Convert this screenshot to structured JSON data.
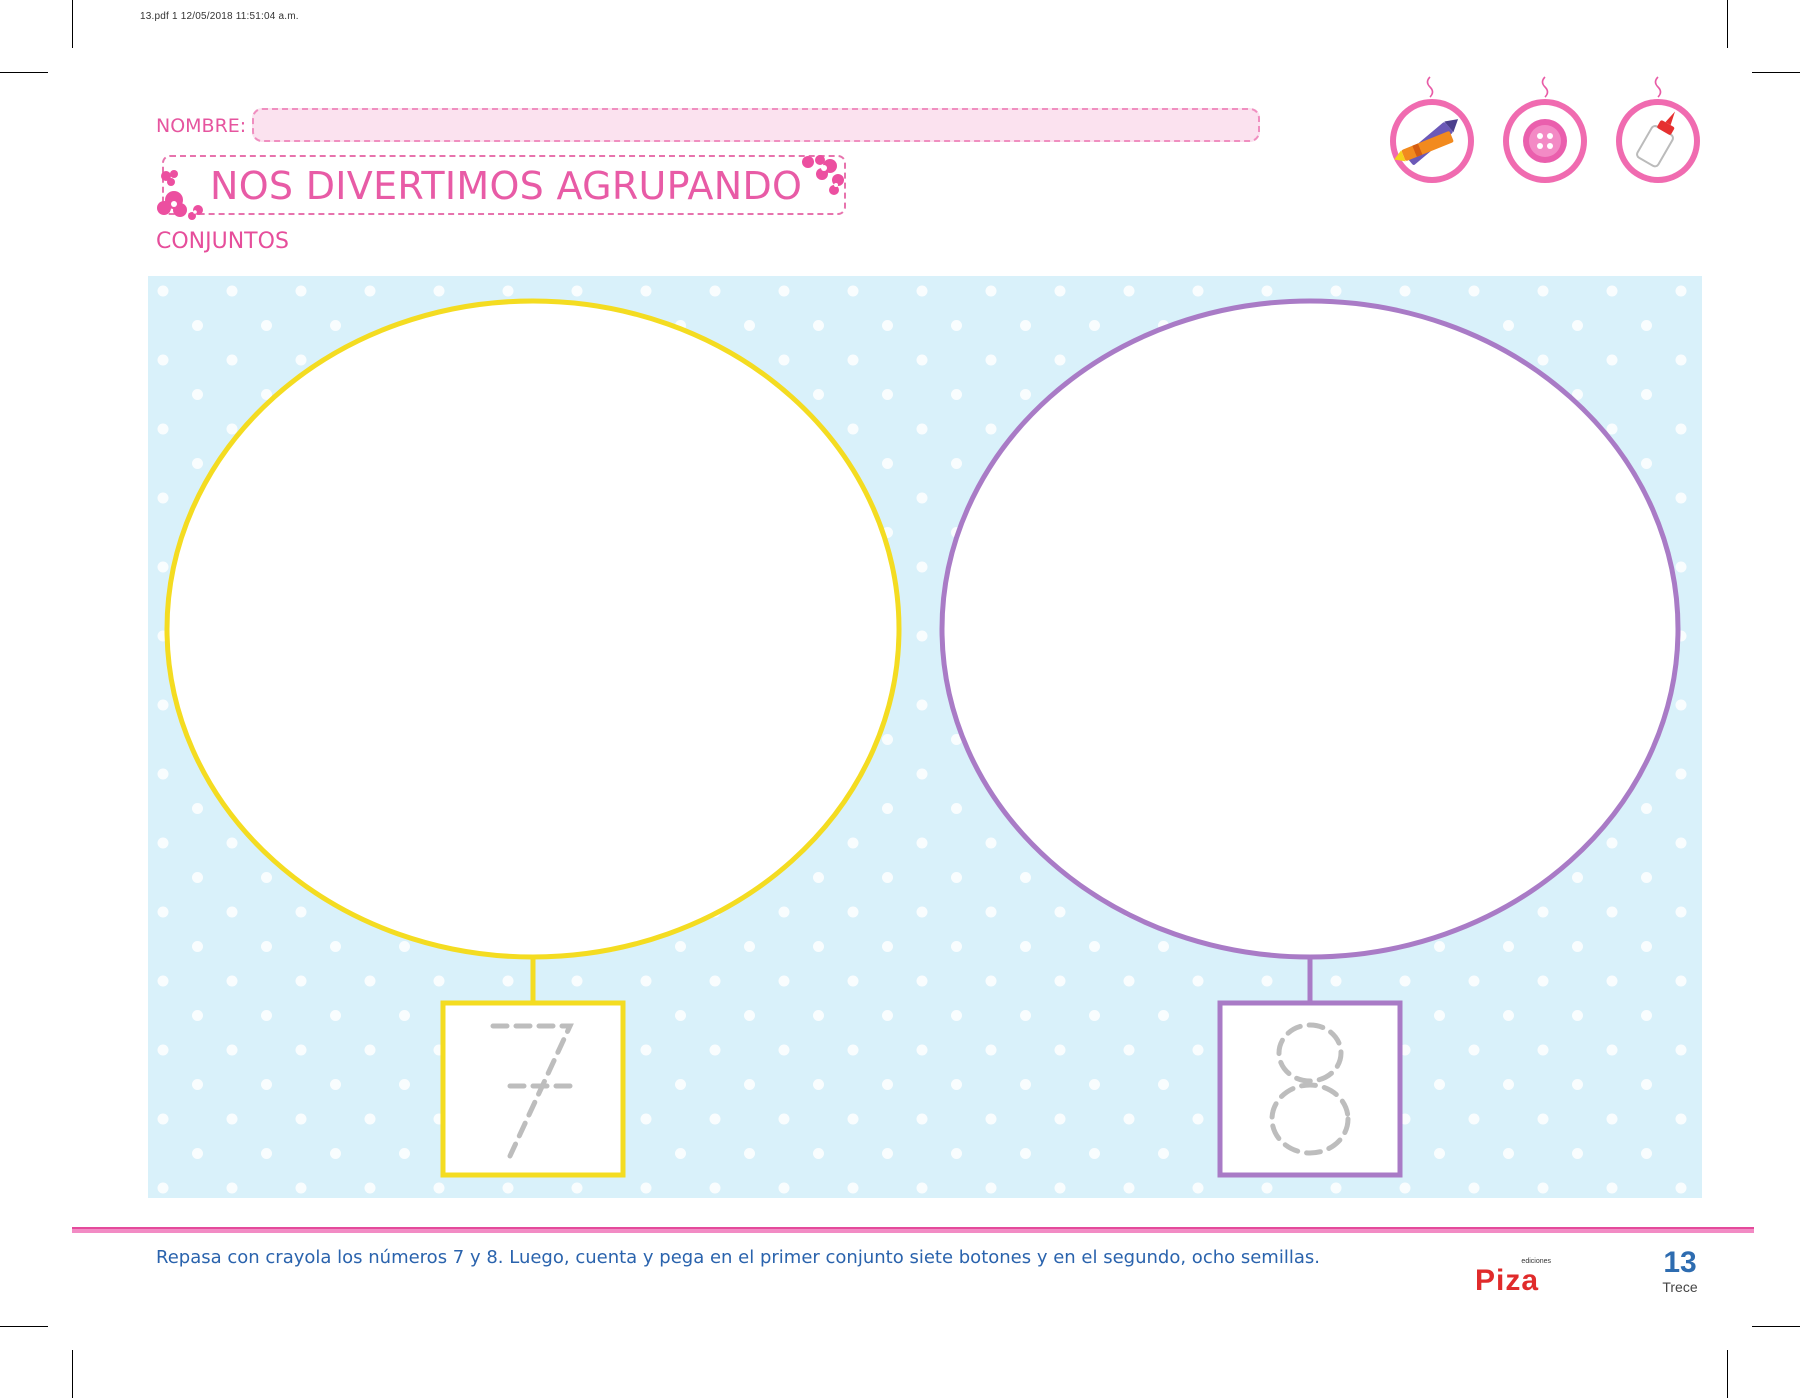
{
  "print_info": "13.pdf   1   12/05/2018   11:51:04 a.m.",
  "header": {
    "name_label": "NOMBRE:",
    "title": "NOS DIVERTIMOS AGRUPANDO",
    "subtitle": "CONJUNTOS"
  },
  "materials": [
    {
      "icon": "crayon-icon"
    },
    {
      "icon": "button-icon"
    },
    {
      "icon": "glue-icon"
    }
  ],
  "activity": {
    "sets": [
      {
        "color": "#f4dc21",
        "trace_number": "7"
      },
      {
        "color": "#a97bc6",
        "trace_number": "8"
      }
    ],
    "background_color": "#d9f1fa"
  },
  "footer": {
    "instruction": "Repasa con crayola los números 7 y 8. Luego, cuenta y pega en el primer conjunto siete botones y en el segundo, ocho semillas.",
    "brand_small": "ediciones",
    "brand": "Piza",
    "page_number": "13",
    "page_word": "Trece"
  },
  "colors": {
    "pink": "#e85ba6",
    "blue_text": "#2a63ad",
    "brand_red": "#e02b2b"
  }
}
